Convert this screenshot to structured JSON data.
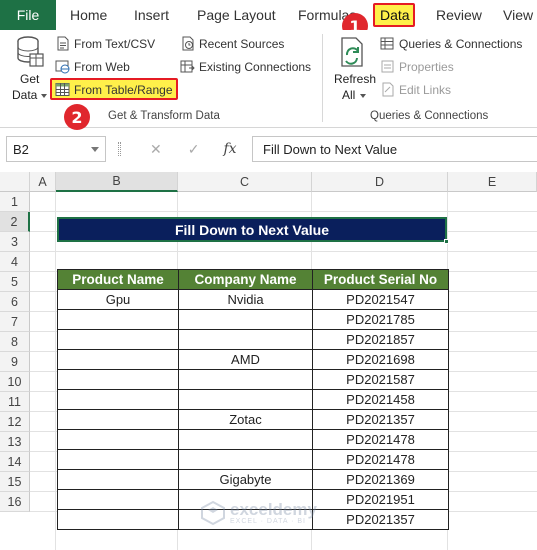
{
  "ribbon_tabs": {
    "file": "File",
    "home": "Home",
    "insert": "Insert",
    "page_layout": "Page Layout",
    "formulas": "Formulas",
    "data": "Data",
    "review": "Review",
    "view": "View"
  },
  "steps": {
    "step1": "1",
    "step2": "2"
  },
  "get_transform": {
    "get_data_line1": "Get",
    "get_data_line2": "Data",
    "from_text_csv": "From Text/CSV",
    "from_web": "From Web",
    "from_table_range": "From Table/Range",
    "recent_sources": "Recent Sources",
    "existing_connections": "Existing Connections",
    "group_label": "Get & Transform Data"
  },
  "queries": {
    "refresh_line1": "Refresh",
    "refresh_line2": "All",
    "queries_connections": "Queries & Connections",
    "properties": "Properties",
    "edit_links": "Edit Links",
    "group_label": "Queries & Connections"
  },
  "formula_bar": {
    "name_box": "B2",
    "cancel_glyph": "✕",
    "enter_glyph": "✓",
    "fx": "fx",
    "content": "Fill Down to Next Value"
  },
  "columns": [
    "A",
    "B",
    "C",
    "D",
    "E"
  ],
  "rows": [
    "1",
    "2",
    "3",
    "4",
    "5",
    "6",
    "7",
    "8",
    "9",
    "10",
    "11",
    "12",
    "13",
    "14",
    "15",
    "16"
  ],
  "sheet": {
    "title": "Fill Down to Next Value",
    "headers": [
      "Product Name",
      "Company Name",
      "Product Serial No"
    ],
    "data": [
      [
        "Gpu",
        "Nvidia",
        "PD2021547"
      ],
      [
        "",
        "",
        "PD2021785"
      ],
      [
        "",
        "",
        "PD2021857"
      ],
      [
        "",
        "AMD",
        "PD2021698"
      ],
      [
        "",
        "",
        "PD2021587"
      ],
      [
        "",
        "",
        "PD2021458"
      ],
      [
        "",
        "Zotac",
        "PD2021357"
      ],
      [
        "",
        "",
        "PD2021478"
      ],
      [
        "",
        "",
        "PD2021478"
      ],
      [
        "",
        "Gigabyte",
        "PD2021369"
      ],
      [
        "",
        "",
        "PD2021951"
      ],
      [
        "",
        "",
        "PD2021357"
      ]
    ]
  },
  "watermark": {
    "name": "exceldemy",
    "tagline": "EXCEL · DATA · BI"
  },
  "colors": {
    "file_tab": "#1e7145",
    "header_fill": "#548235",
    "title_fill": "#0a1f5c",
    "highlight": "#fff04a",
    "badge": "#e0272d"
  }
}
